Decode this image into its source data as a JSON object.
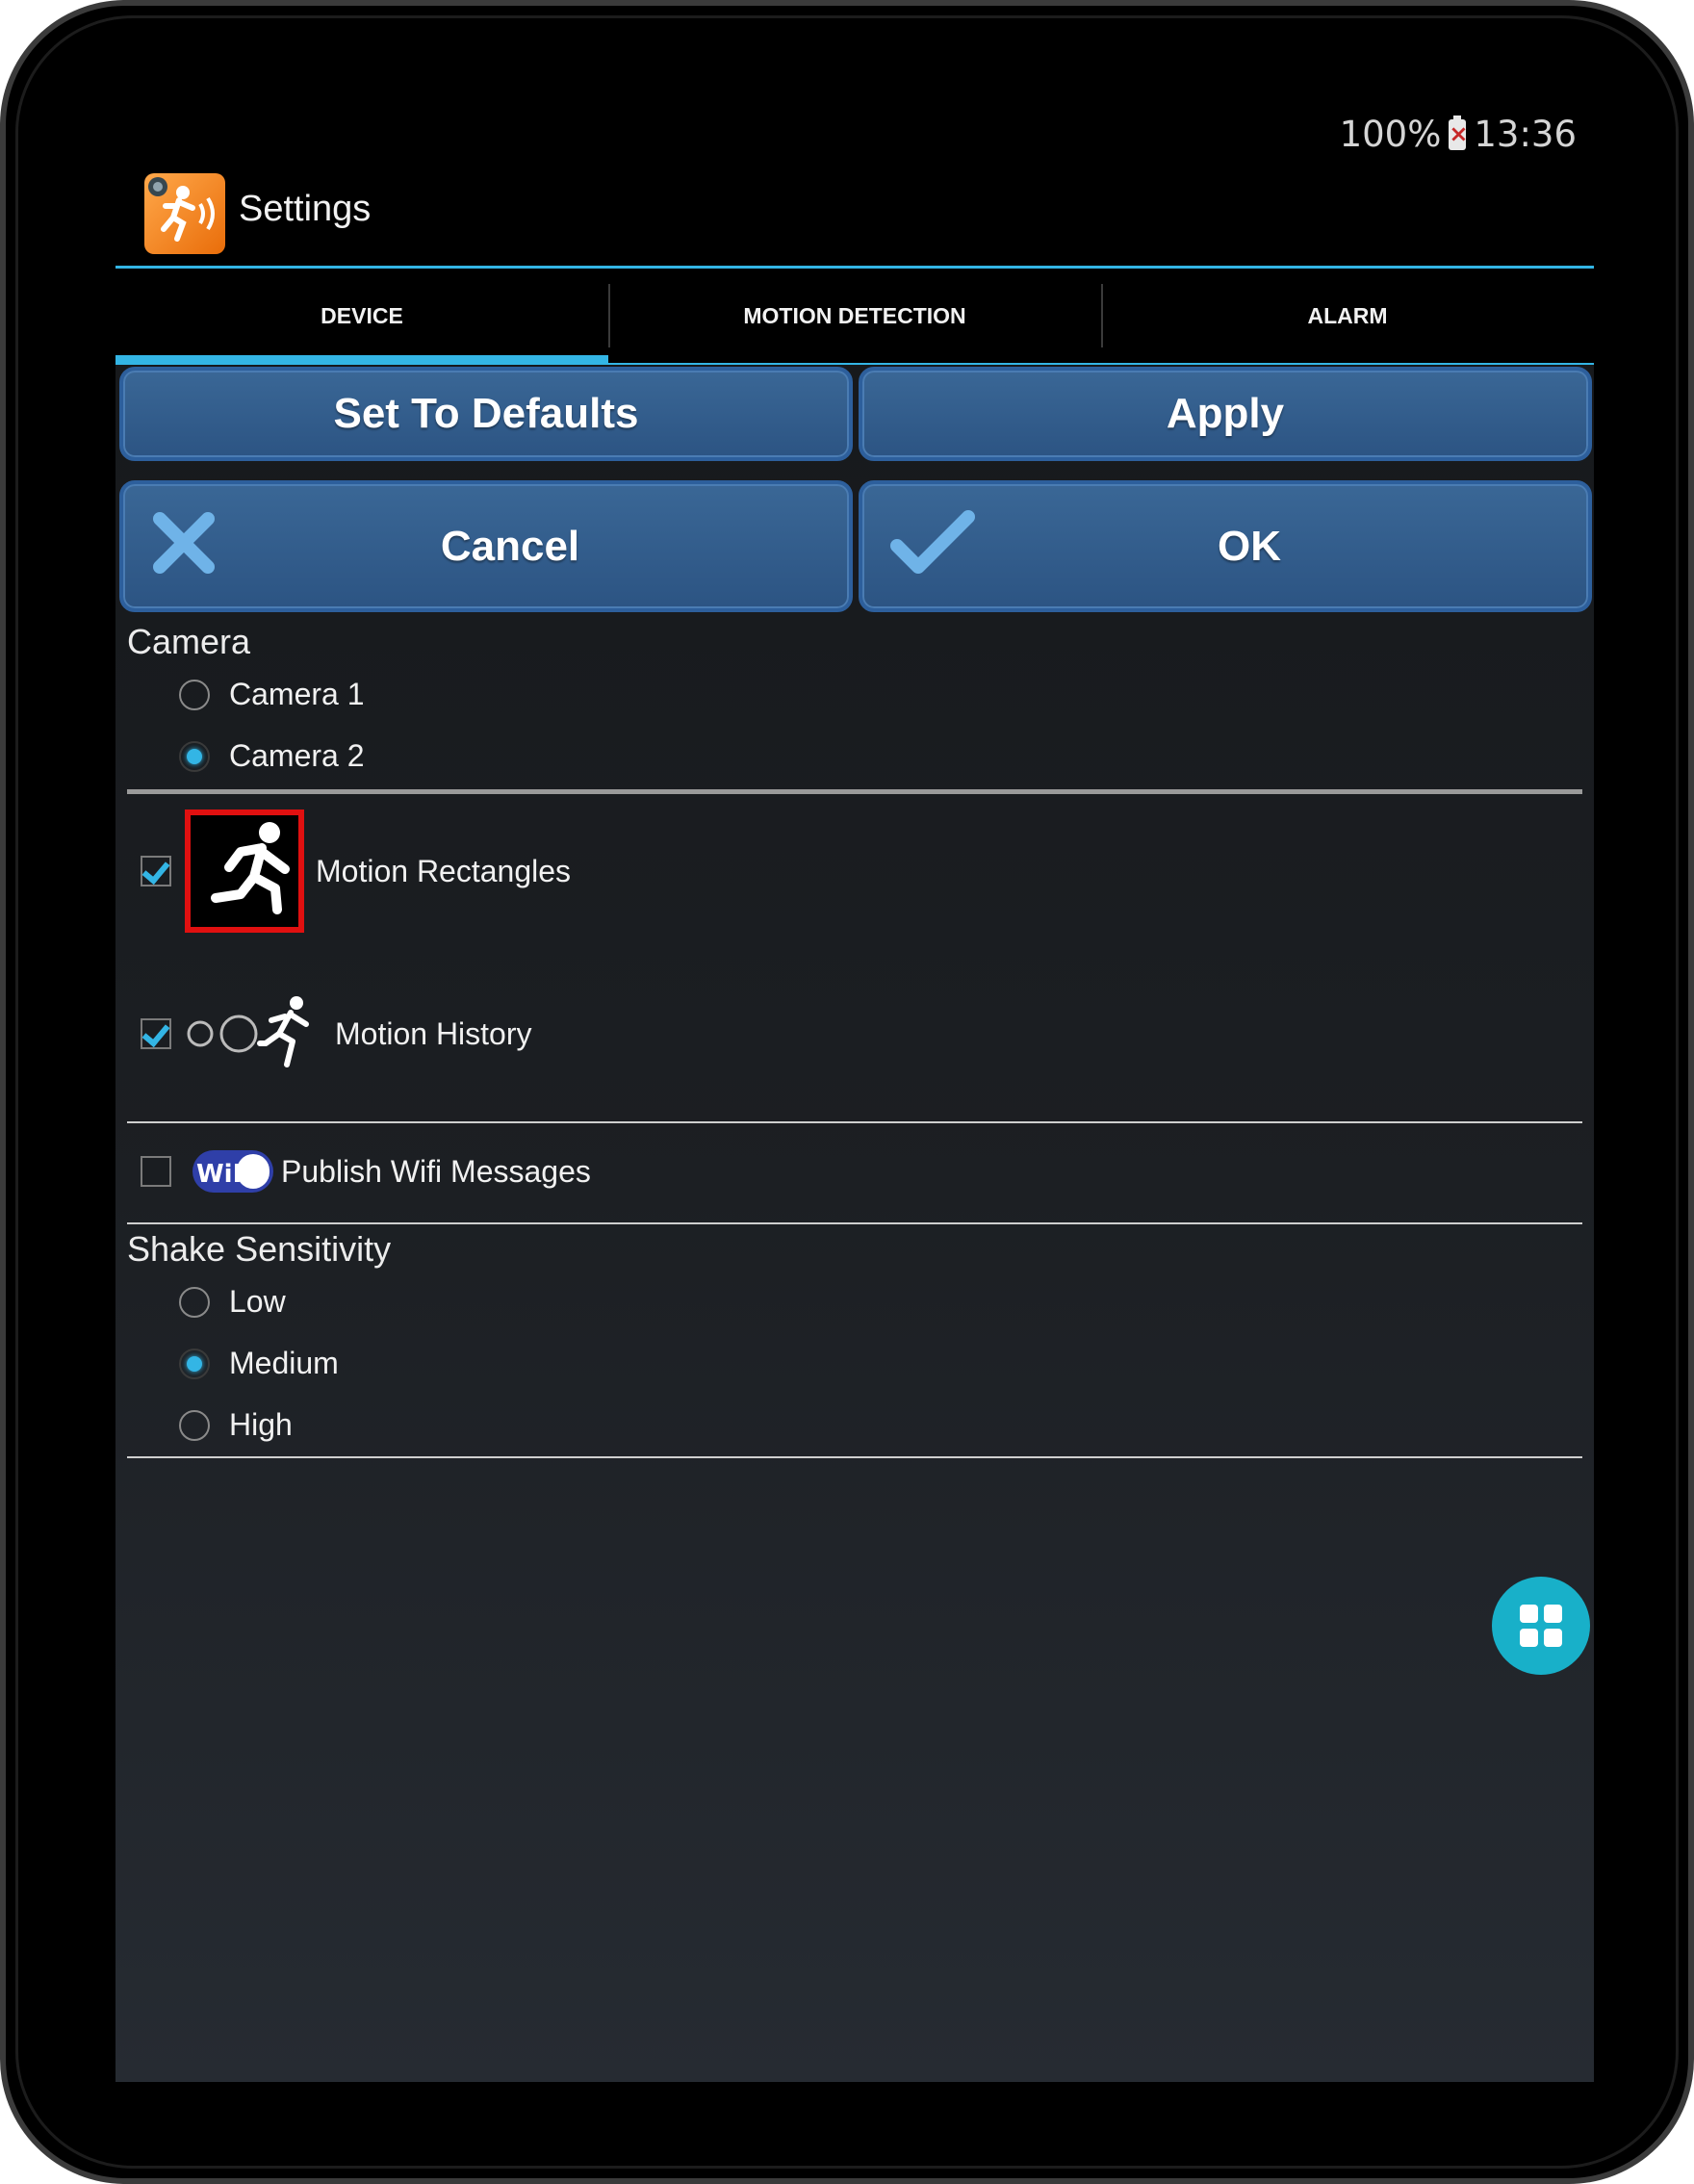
{
  "status_bar": {
    "battery": "100%",
    "time": "13:36"
  },
  "action_bar": {
    "title": "Settings",
    "app_icon": "running-man-app-icon"
  },
  "tabs": [
    {
      "label": "DEVICE",
      "active": true
    },
    {
      "label": "MOTION DETECTION",
      "active": false
    },
    {
      "label": "ALARM",
      "active": false
    }
  ],
  "buttons": {
    "set_defaults": "Set To Defaults",
    "apply": "Apply",
    "cancel": "Cancel",
    "ok": "OK"
  },
  "camera": {
    "title": "Camera",
    "options": [
      {
        "label": "Camera 1",
        "selected": false
      },
      {
        "label": "Camera 2",
        "selected": true
      }
    ]
  },
  "options": {
    "motion_rectangles": {
      "label": "Motion Rectangles",
      "checked": true
    },
    "motion_history": {
      "label": "Motion History",
      "checked": true
    },
    "publish_wifi": {
      "label": "Publish Wifi Messages",
      "checked": false,
      "badge": "WiFi"
    }
  },
  "shake": {
    "title": "Shake Sensitivity",
    "options": [
      {
        "label": "Low",
        "selected": false
      },
      {
        "label": "Medium",
        "selected": true
      },
      {
        "label": "High",
        "selected": false
      }
    ]
  },
  "colors": {
    "accent": "#33b5e5",
    "button": "#2c5483",
    "fab": "#18b0c9"
  }
}
